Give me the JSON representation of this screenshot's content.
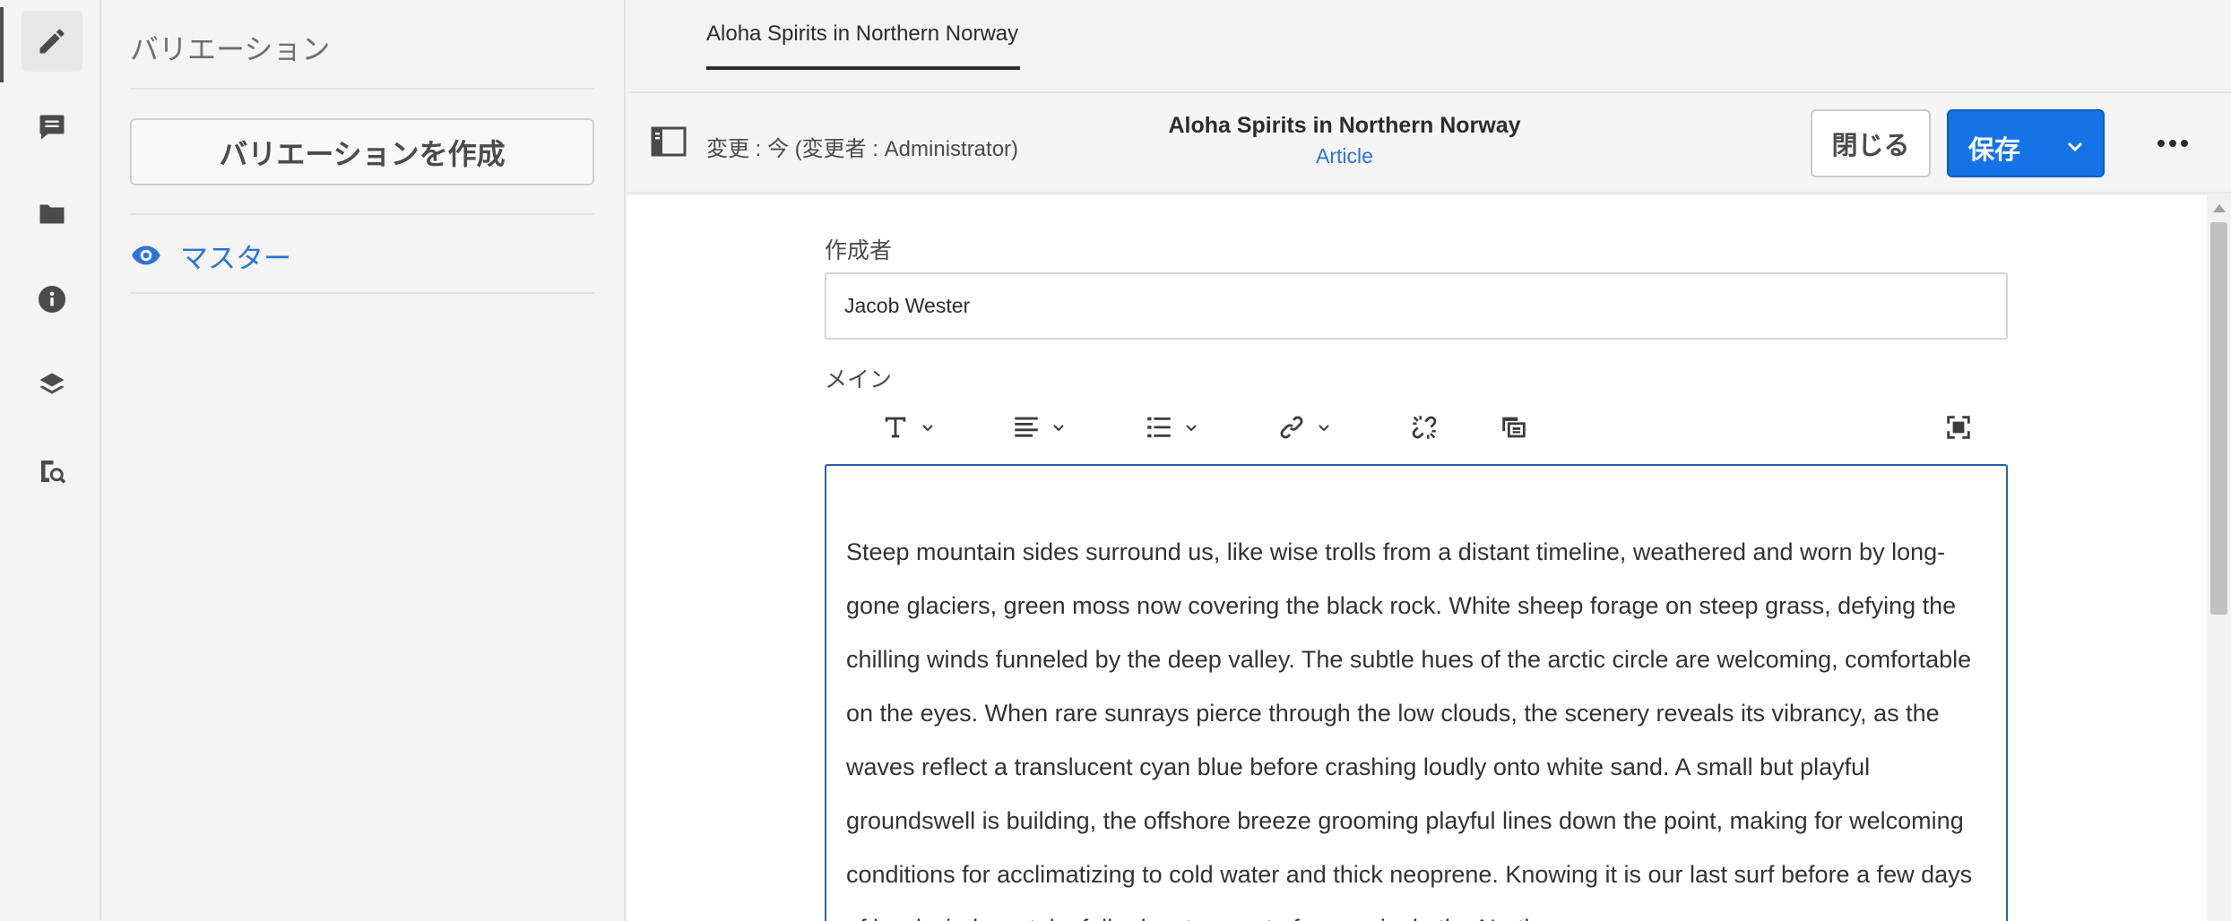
{
  "rail": {
    "icons": [
      "pencil-icon",
      "comment-icon",
      "folder-icon",
      "info-icon",
      "layers-icon",
      "asset-search-icon"
    ]
  },
  "variations_panel": {
    "title": "バリエーション",
    "create_button": "バリエーションを作成",
    "master_label": "マスター"
  },
  "tabs": [
    {
      "label": "Aloha Spirits in Northern Norway",
      "active": true
    }
  ],
  "header": {
    "modified": "変更 : 今 (変更者 : Administrator)",
    "title": "Aloha Spirits in Northern Norway",
    "model": "Article",
    "close_button": "閉じる",
    "save_button": "保存"
  },
  "form": {
    "author_label": "作成者",
    "author_value": "Jacob Wester",
    "main_label": "メイン",
    "main_text": "Steep mountain sides surround us, like wise trolls from a distant timeline, weathered and worn by long-gone glaciers, green moss now covering the black rock. White sheep forage on steep grass, defying the chilling winds funneled by the deep valley. The subtle hues of the arctic circle are welcoming, comfortable on the eyes. When rare sunrays pierce through the low clouds, the scenery reveals its vibrancy, as the waves reflect a translucent cyan blue before crashing loudly onto white sand. A small but playful groundswell is building, the offshore breeze grooming playful lines down the point, making for welcoming conditions for acclimatizing to cold water and thick neoprene. Knowing it is our last surf before a few days of hard wind, we take full advantage out of every ripple the North"
  },
  "toolbar": {
    "tools": [
      "text-format-icon",
      "align-icon",
      "list-icon",
      "link-icon",
      "unlink-icon",
      "insert-fragment-icon",
      "fullscreen-icon"
    ]
  },
  "colors": {
    "accent": "#1473e6",
    "link": "#2c74d6",
    "focus_border": "#2c5fb0"
  }
}
